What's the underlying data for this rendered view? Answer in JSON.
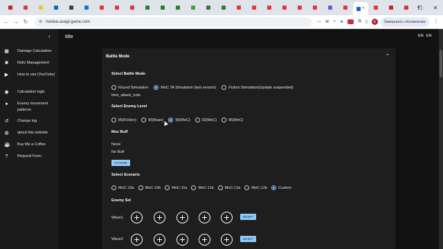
{
  "browser": {
    "tab_count": 27,
    "url": "honkai.asagi-game.com",
    "update_label": "Завершить обновление",
    "avatar_letter": "E"
  },
  "sidebar": {
    "items": [
      {
        "label": "Damage Calculation",
        "icon": "calculator-icon"
      },
      {
        "label": "Relic Management",
        "icon": "tools-icon"
      },
      {
        "label": "How to use (YouTube)",
        "icon": "youtube-icon"
      },
      {
        "label": "Calculation logic",
        "icon": "chat-icon"
      },
      {
        "label": "Enemy movement patterns",
        "icon": "location-icon"
      },
      {
        "label": "Change log",
        "icon": "history-icon"
      },
      {
        "label": "about this website",
        "icon": "globe-icon"
      },
      {
        "label": "Buy Me a Coffee",
        "icon": "coffee-icon"
      },
      {
        "label": "Request Form",
        "icon": "help-icon"
      }
    ]
  },
  "topbar": {
    "title": "title",
    "lang1": "EN",
    "lang2": "EN"
  },
  "panel": {
    "heading": "Battle Mode",
    "battle_mode": {
      "heading": "Select Battle Mode",
      "options": [
        "Round Simulation",
        "MoC TA Simulation (test version)",
        "Fiction Simulation(Update suspended)"
      ],
      "selected": 1,
      "note": "time_attack_note"
    },
    "enemy_level": {
      "heading": "Select Enemy Level",
      "options": [
        "85(Fiction)",
        "90(Base)",
        "90(MoC)",
        "92(MoC)",
        "95(MoC)"
      ],
      "selected": 2
    },
    "moc_buff": {
      "heading": "Moc Buff",
      "line1": "None",
      "line2": "No Buff",
      "button": "CHANGE"
    },
    "scenario": {
      "heading": "Select Scenario",
      "options": [
        "MoC-10a",
        "MoC-10b",
        "MoC-11a",
        "MoC-11b",
        "MoC-12a",
        "MoC-12b",
        "Custom"
      ],
      "selected": 6
    },
    "enemy_set": {
      "heading": "Enemy Set",
      "waves": [
        {
          "label": "Wave1",
          "reset": "RESET"
        },
        {
          "label": "Wave2",
          "reset": "RESET"
        }
      ]
    }
  }
}
